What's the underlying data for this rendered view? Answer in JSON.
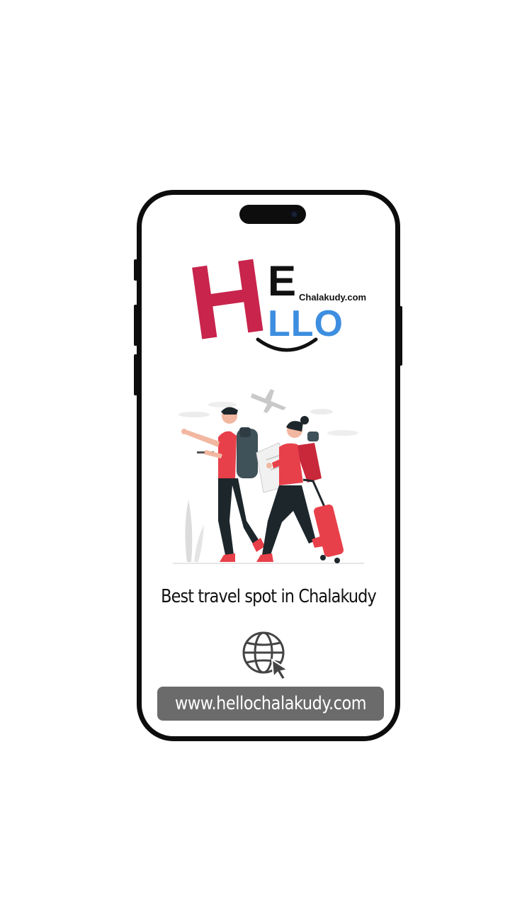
{
  "logo": {
    "letter_h": "H",
    "letter_e": "E",
    "letters_llo": "LLO",
    "domain_text": "Chalakudy.com"
  },
  "tagline": "Best travel spot in Chalakudy",
  "website": {
    "icon": "globe-cursor-icon",
    "url": "www.hellochalakudy.com"
  },
  "colors": {
    "logo_red": "#c8244c",
    "logo_blue": "#3d8ee0",
    "traveler_red": "#e8404a",
    "pill_gray": "#6b6b6b"
  }
}
